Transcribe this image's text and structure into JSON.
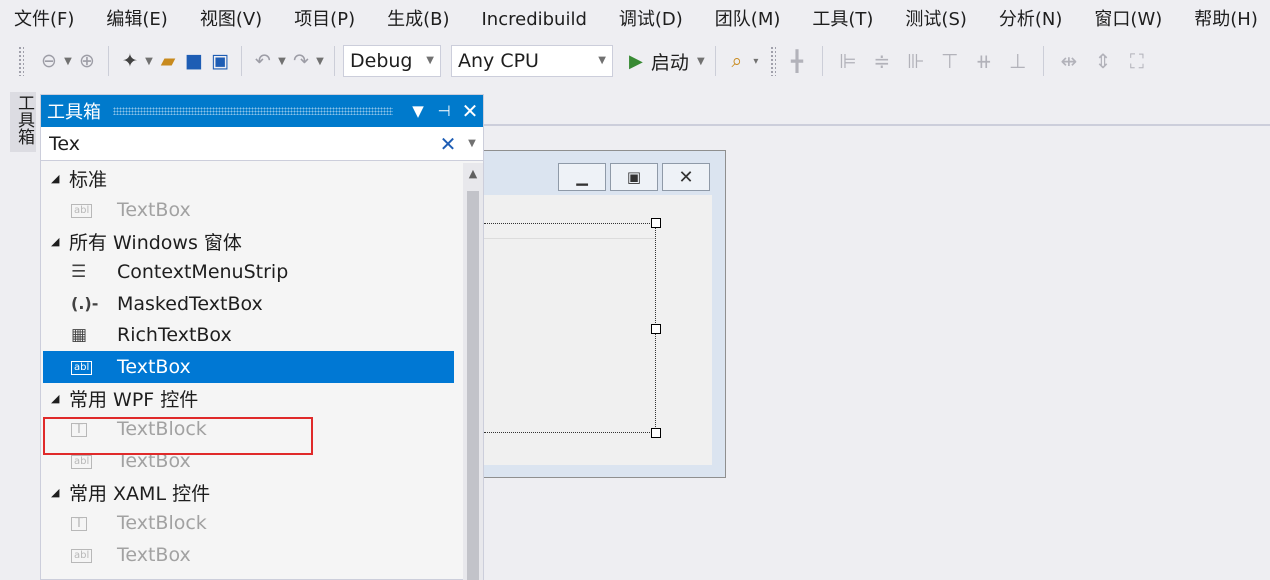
{
  "menu": [
    "文件(F)",
    "编辑(E)",
    "视图(V)",
    "项目(P)",
    "生成(B)",
    "Incredibuild",
    "调试(D)",
    "团队(M)",
    "工具(T)",
    "测试(S)",
    "分析(N)",
    "窗口(W)",
    "帮助(H)"
  ],
  "toolbar": {
    "config_value": "Debug",
    "platform_value": "Any CPU",
    "start_label": "启动"
  },
  "side_tab_label": "工具箱",
  "toolbox": {
    "title": "工具箱",
    "search_value": "Tex",
    "groups": [
      {
        "label": "标准",
        "items": [
          {
            "label": "TextBox",
            "icon": "abl-icon",
            "enabled": false
          }
        ]
      },
      {
        "label": "所有 Windows 窗体",
        "items": [
          {
            "label": "ContextMenuStrip",
            "icon": "context-menu-icon",
            "enabled": true
          },
          {
            "label": "MaskedTextBox",
            "icon": "masked-icon",
            "enabled": true
          },
          {
            "label": "RichTextBox",
            "icon": "richtext-icon",
            "enabled": true
          },
          {
            "label": "TextBox",
            "icon": "abl-icon",
            "enabled": true,
            "selected": true
          }
        ]
      },
      {
        "label": "常用 WPF 控件",
        "items": [
          {
            "label": "TextBlock",
            "icon": "textblock-icon",
            "enabled": false
          },
          {
            "label": "TextBox",
            "icon": "abl-icon",
            "enabled": false
          }
        ]
      },
      {
        "label": "常用 XAML 控件",
        "items": [
          {
            "label": "TextBlock",
            "icon": "textblock-icon",
            "enabled": false
          },
          {
            "label": "TextBox",
            "icon": "abl-icon",
            "enabled": false
          }
        ]
      }
    ]
  },
  "colors": {
    "accent": "#007acc",
    "selection": "#0078d4",
    "highlight_border": "#e02a2a",
    "start_green": "#388a34"
  }
}
